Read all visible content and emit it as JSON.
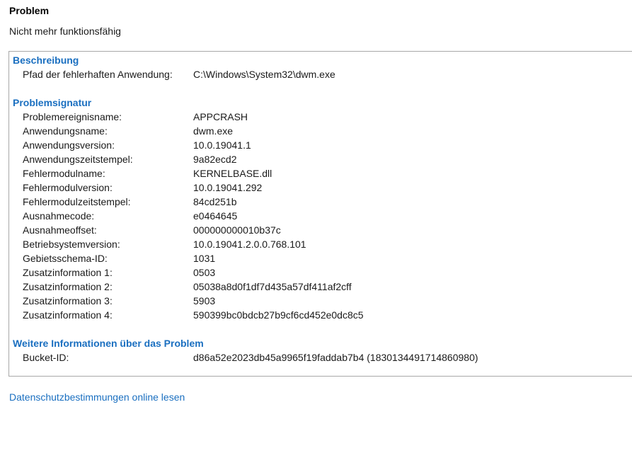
{
  "problem": {
    "title": "Problem",
    "status": "Nicht mehr funktionsfähig"
  },
  "description": {
    "header": "Beschreibung",
    "rows": [
      {
        "label": "Pfad der fehlerhaften Anwendung:",
        "value": "C:\\Windows\\System32\\dwm.exe"
      }
    ]
  },
  "signature": {
    "header": "Problemsignatur",
    "rows": [
      {
        "label": "Problemereignisname:",
        "value": "APPCRASH"
      },
      {
        "label": "Anwendungsname:",
        "value": "dwm.exe"
      },
      {
        "label": "Anwendungsversion:",
        "value": "10.0.19041.1"
      },
      {
        "label": "Anwendungszeitstempel:",
        "value": "9a82ecd2"
      },
      {
        "label": "Fehlermodulname:",
        "value": "KERNELBASE.dll"
      },
      {
        "label": "Fehlermodulversion:",
        "value": "10.0.19041.292"
      },
      {
        "label": "Fehlermodulzeitstempel:",
        "value": "84cd251b"
      },
      {
        "label": "Ausnahmecode:",
        "value": "e0464645"
      },
      {
        "label": "Ausnahmeoffset:",
        "value": "000000000010b37c"
      },
      {
        "label": "Betriebsystemversion:",
        "value": "10.0.19041.2.0.0.768.101"
      },
      {
        "label": "Gebietsschema-ID:",
        "value": "1031"
      },
      {
        "label": "Zusatzinformation 1:",
        "value": "0503"
      },
      {
        "label": "Zusatzinformation 2:",
        "value": "05038a8d0f1df7d435a57df411af2cff"
      },
      {
        "label": "Zusatzinformation 3:",
        "value": "5903"
      },
      {
        "label": "Zusatzinformation 4:",
        "value": "590399bc0bdcb27b9cf6cd452e0dc8c5"
      }
    ]
  },
  "more_info": {
    "header": "Weitere Informationen über das Problem",
    "rows": [
      {
        "label": "Bucket-ID:",
        "value": "d86a52e2023db45a9965f19faddab7b4 (1830134491714860980)"
      }
    ]
  },
  "privacy_link": "Datenschutzbestimmungen online lesen",
  "colors": {
    "accent": "#1a6fc0",
    "border": "#a8a8a8"
  }
}
